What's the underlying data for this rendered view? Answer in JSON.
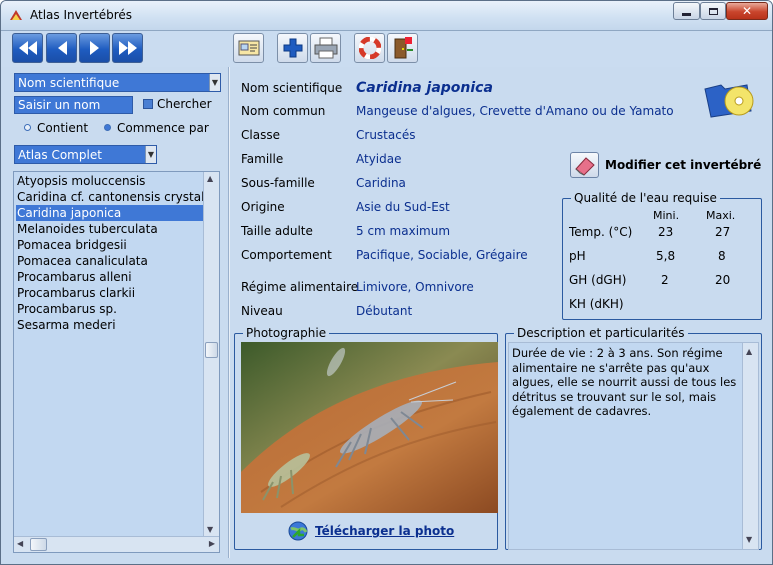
{
  "window": {
    "title": "Atlas Invertébrés"
  },
  "toolbar": {
    "buttons": [
      {
        "name": "first-record-button",
        "icon": "double-left-arrow-icon"
      },
      {
        "name": "previous-record-button",
        "icon": "left-arrow-icon"
      },
      {
        "name": "next-record-button",
        "icon": "right-arrow-icon"
      },
      {
        "name": "last-record-button",
        "icon": "double-right-arrow-icon"
      },
      {
        "name": "card-view-button",
        "icon": "card-icon"
      },
      {
        "name": "add-button",
        "icon": "plus-icon"
      },
      {
        "name": "print-button",
        "icon": "printer-icon"
      },
      {
        "name": "help-button",
        "icon": "lifebuoy-icon"
      },
      {
        "name": "exit-button",
        "icon": "exit-door-icon"
      }
    ]
  },
  "sidebar": {
    "field_select": "Nom scientifique",
    "search": {
      "value": "Saisir un nom"
    },
    "search_label": "Chercher",
    "mode": {
      "contains": "Contient",
      "starts_with": "Commence par",
      "selected": "starts_with"
    },
    "atlas_select": "Atlas Complet",
    "items": [
      {
        "label": "Atyopsis moluccensis",
        "selected": false
      },
      {
        "label": "Caridina cf. cantonensis crystal r",
        "selected": false
      },
      {
        "label": "Caridina japonica",
        "selected": true
      },
      {
        "label": "Melanoides tuberculata",
        "selected": false
      },
      {
        "label": "Pomacea bridgesii",
        "selected": false
      },
      {
        "label": "Pomacea canaliculata",
        "selected": false
      },
      {
        "label": "Procambarus alleni",
        "selected": false
      },
      {
        "label": "Procambarus clarkii",
        "selected": false
      },
      {
        "label": "Procambarus sp.",
        "selected": false
      },
      {
        "label": "Sesarma mederi",
        "selected": false
      }
    ]
  },
  "details": {
    "fields": [
      {
        "label": "Nom scientifique",
        "value": "Caridina japonica"
      },
      {
        "label": "Nom commun",
        "value": "Mangeuse d'algues, Crevette d'Amano ou de Yamato"
      },
      {
        "label": "Classe",
        "value": "Crustacés"
      },
      {
        "label": "Famille",
        "value": "Atyidae"
      },
      {
        "label": "Sous-famille",
        "value": "Caridina"
      },
      {
        "label": "Origine",
        "value": "Asie du Sud-Est"
      },
      {
        "label": "Taille adulte",
        "value": "5 cm maximum"
      },
      {
        "label": "Comportement",
        "value": "Pacifique, Sociable, Grégaire"
      },
      {
        "label": "Régime alimentaire",
        "value": "Limivore, Omnivore"
      },
      {
        "label": "Niveau",
        "value": "Débutant"
      }
    ],
    "edit_label": "Modifier cet invertébré",
    "water": {
      "title": "Qualité de l'eau requise",
      "min_header": "Mini.",
      "max_header": "Maxi.",
      "rows": [
        {
          "label": "Temp. (°C)",
          "min": "23",
          "max": "27"
        },
        {
          "label": "pH",
          "min": "5,8",
          "max": "8"
        },
        {
          "label": "GH (dGH)",
          "min": "2",
          "max": "20"
        },
        {
          "label": "KH (dKH)",
          "min": "",
          "max": ""
        }
      ]
    },
    "photo": {
      "title": "Photographie",
      "download_label": "Télécharger la photo"
    },
    "description": {
      "title": "Description et particularités",
      "text": "Durée de vie : 2 à 3 ans. Son régime alimentaire ne s'arrête pas qu'aux algues, elle se nourrit aussi de tous les détritus se trouvant sur le sol, mais également de cadavres."
    }
  },
  "colors": {
    "accent": "#3f78d6",
    "value_text": "#0b2f8f",
    "background": "#c9dbef"
  }
}
